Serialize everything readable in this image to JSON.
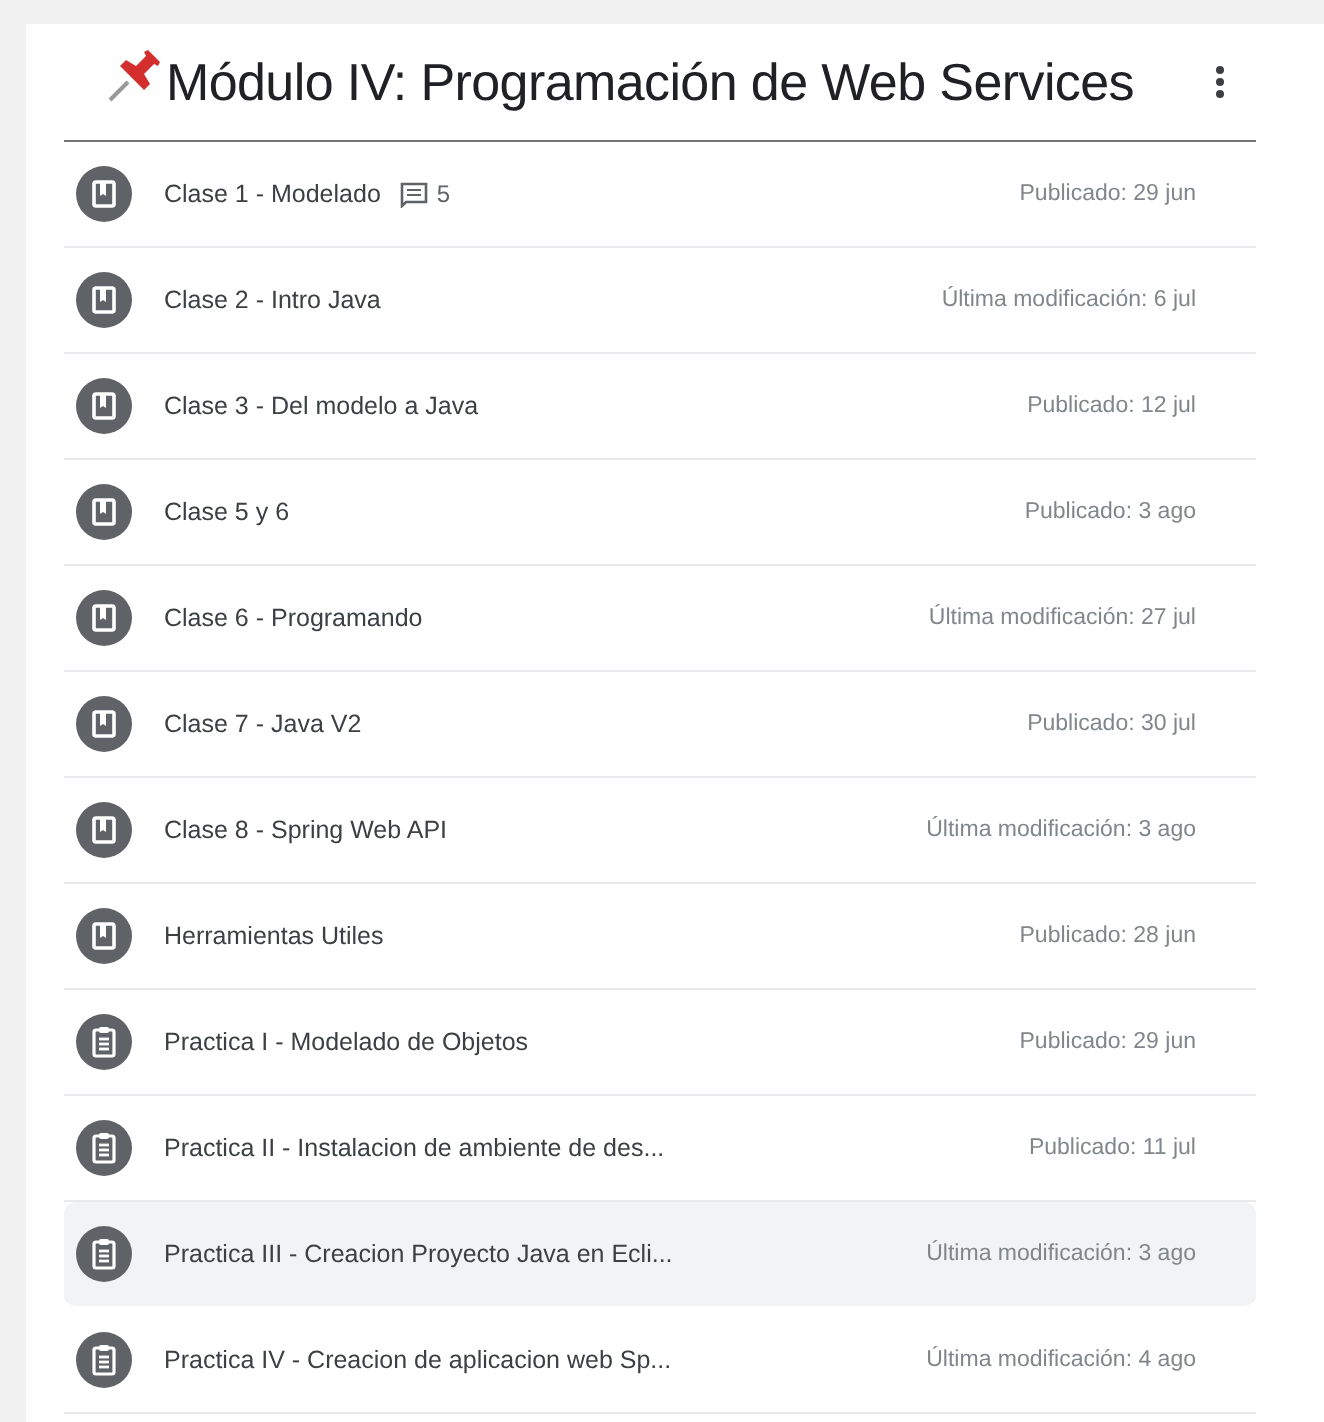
{
  "topic": {
    "title": "Módulo IV: Programación de Web Services",
    "pinned": true
  },
  "items": [
    {
      "kind": "material",
      "title": "Clase 1 - Modelado",
      "comments": "5",
      "date": "Publicado: 29 jun",
      "highlighted": false
    },
    {
      "kind": "material",
      "title": "Clase 2 - Intro Java",
      "date": "Última modificación: 6 jul",
      "highlighted": false
    },
    {
      "kind": "material",
      "title": "Clase 3 - Del modelo a Java",
      "date": "Publicado: 12 jul",
      "highlighted": false
    },
    {
      "kind": "material",
      "title": "Clase 5 y 6",
      "date": "Publicado: 3 ago",
      "highlighted": false
    },
    {
      "kind": "material",
      "title": "Clase 6 - Programando",
      "date": "Última modificación: 27 jul",
      "highlighted": false
    },
    {
      "kind": "material",
      "title": "Clase 7 - Java V2",
      "date": "Publicado: 30 jul",
      "highlighted": false
    },
    {
      "kind": "material",
      "title": "Clase 8 - Spring Web API",
      "date": "Última modificación: 3 ago",
      "highlighted": false
    },
    {
      "kind": "material",
      "title": "Herramientas Utiles",
      "date": "Publicado: 28 jun",
      "highlighted": false
    },
    {
      "kind": "assignment",
      "title": "Practica I - Modelado de Objetos",
      "date": "Publicado: 29 jun",
      "highlighted": false
    },
    {
      "kind": "assignment",
      "title": "Practica II - Instalacion de ambiente de des...",
      "date": "Publicado: 11 jul",
      "highlighted": false
    },
    {
      "kind": "assignment",
      "title": "Practica III - Creacion Proyecto Java en Ecli...",
      "date": "Última modificación: 3 ago",
      "highlighted": true
    },
    {
      "kind": "assignment",
      "title": "Practica IV - Creacion de aplicacion web Sp...",
      "date": "Última modificación: 4 ago",
      "highlighted": false
    }
  ]
}
